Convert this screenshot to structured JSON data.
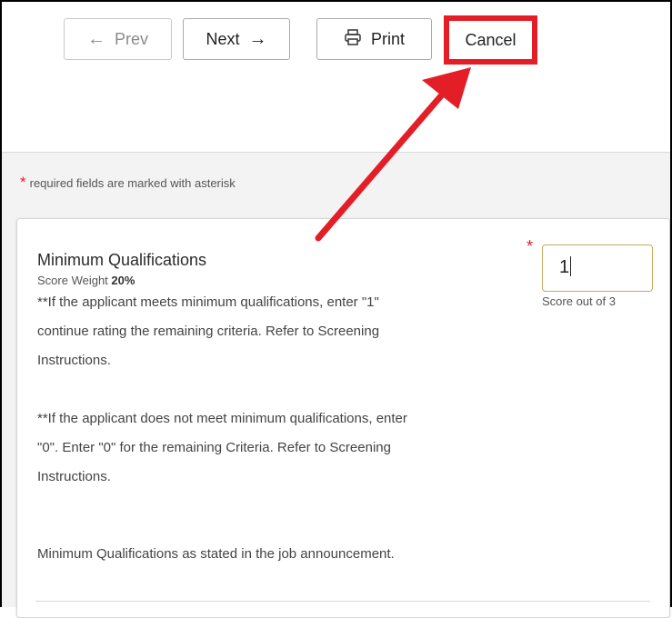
{
  "toolbar": {
    "prev_label": "Prev",
    "prev_icon": "←",
    "next_label": "Next",
    "next_icon": "→",
    "print_label": "Print",
    "cancel_label": "Cancel"
  },
  "form": {
    "required_note": "required fields are marked with asterisk",
    "required_star": "*"
  },
  "criterion": {
    "title": "Minimum Qualifications",
    "weight_label": "Score Weight",
    "weight_value": "20%",
    "paragraphs": [
      "**If the applicant meets minimum qualifications, enter \"1\" continue rating the remaining criteria. Refer to Screening Instructions.",
      "**If the applicant does not meet minimum qualifications, enter \"0\". Enter \"0\" for the remaining Criteria. Refer to Screening Instructions.",
      "Minimum Qualifications as stated in the job announcement."
    ],
    "score_value": "1",
    "score_label": "Score out of 3"
  },
  "colors": {
    "accent_red": "#e41e26",
    "input_border": "#c8a960"
  }
}
